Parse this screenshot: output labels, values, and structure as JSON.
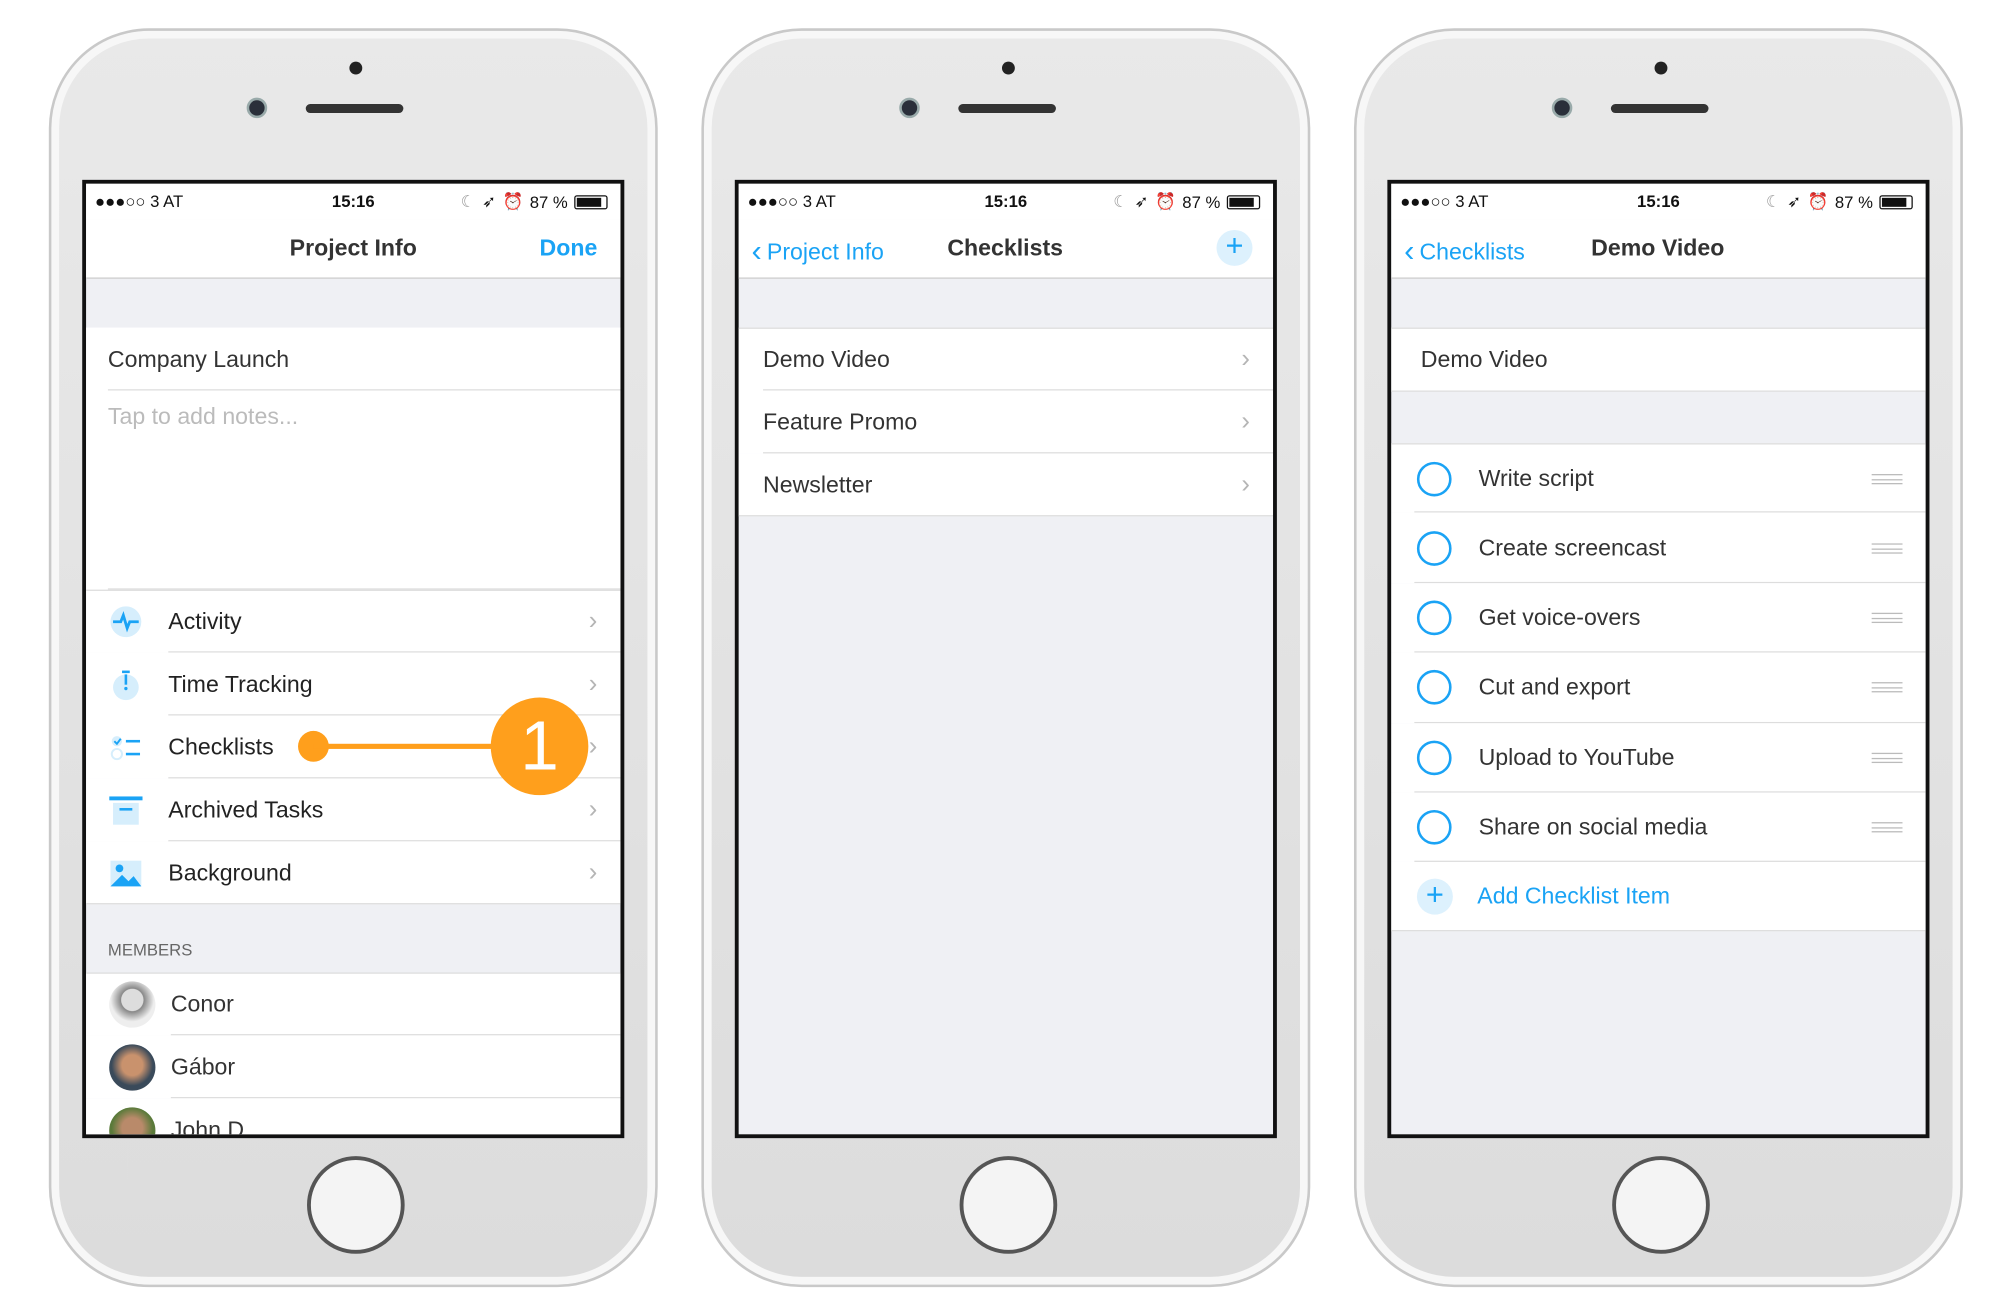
{
  "status": {
    "carrier": "●●●○○ 3 AT",
    "time": "15:16",
    "battery": "87 %"
  },
  "colors": {
    "accent": "#1aa3f5",
    "callout": "#ff9f1c",
    "section_bg": "#eff0f4"
  },
  "phone1": {
    "nav": {
      "title": "Project Info",
      "done": "Done"
    },
    "project_name": "Company Launch",
    "notes_placeholder": "Tap to add notes...",
    "menu": [
      {
        "label": "Activity",
        "icon": "activity-icon"
      },
      {
        "label": "Time Tracking",
        "icon": "stopwatch-icon"
      },
      {
        "label": "Checklists",
        "icon": "checklist-icon"
      },
      {
        "label": "Archived Tasks",
        "icon": "archive-icon"
      },
      {
        "label": "Background",
        "icon": "image-icon"
      }
    ],
    "members_header": "MEMBERS",
    "members": [
      "Conor",
      "Gábor",
      "John D."
    ],
    "callout_number": "1"
  },
  "phone2": {
    "nav": {
      "back": "Project Info",
      "title": "Checklists"
    },
    "items": [
      "Demo Video",
      "Feature Promo",
      "Newsletter"
    ]
  },
  "phone3": {
    "nav": {
      "back": "Checklists",
      "title": "Demo Video"
    },
    "checklist_name": "Demo Video",
    "items": [
      "Write script",
      "Create screencast",
      "Get voice-overs",
      "Cut and export",
      "Upload to YouTube",
      "Share on social media"
    ],
    "add_label": "Add Checklist Item"
  }
}
